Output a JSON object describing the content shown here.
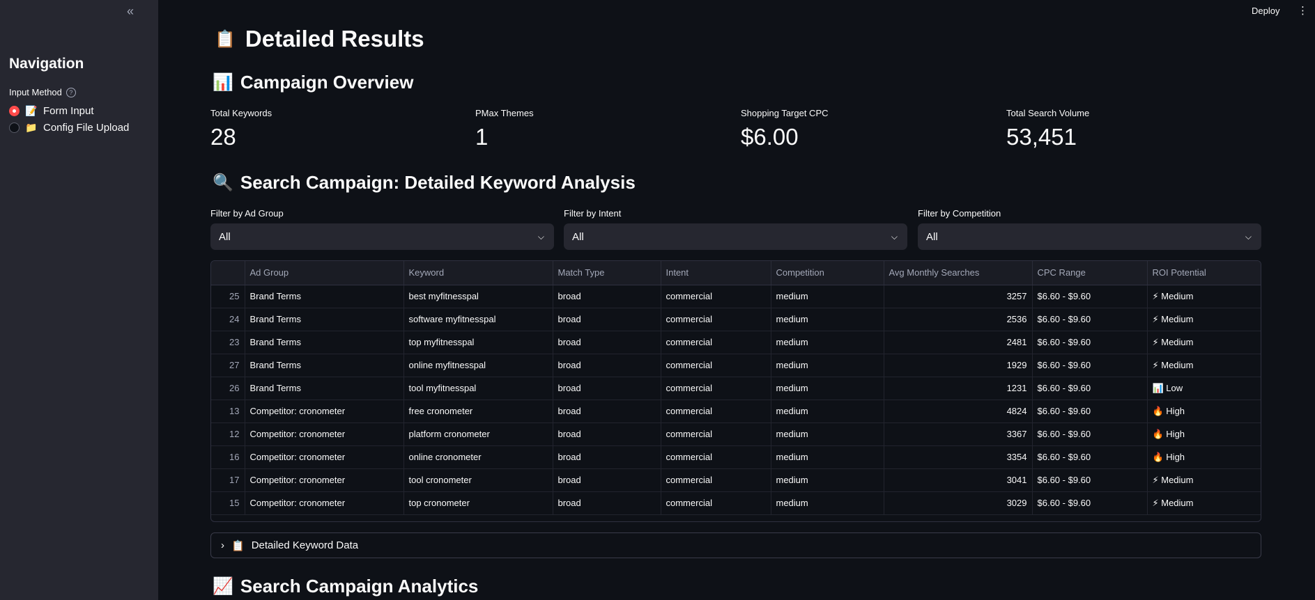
{
  "sidebar": {
    "collapse_glyph": "«",
    "title": "Navigation",
    "input_method_label": "Input Method",
    "help_glyph": "?",
    "options": [
      {
        "icon": "📝",
        "label": "Form Input",
        "selected": true
      },
      {
        "icon": "📁",
        "label": "Config File Upload",
        "selected": false
      }
    ]
  },
  "header": {
    "deploy_label": "Deploy",
    "menu_glyph": "⋮"
  },
  "main": {
    "title_icon": "📋",
    "title": "Detailed Results",
    "overview_icon": "📊",
    "overview_title": "Campaign Overview",
    "metrics": [
      {
        "label": "Total Keywords",
        "value": "28"
      },
      {
        "label": "PMax Themes",
        "value": "1"
      },
      {
        "label": "Shopping Target CPC",
        "value": "$6.00"
      },
      {
        "label": "Total Search Volume",
        "value": "53,451"
      }
    ],
    "search_icon": "🔍",
    "search_title": "Search Campaign: Detailed Keyword Analysis",
    "filters": [
      {
        "label": "Filter by Ad Group",
        "value": "All"
      },
      {
        "label": "Filter by Intent",
        "value": "All"
      },
      {
        "label": "Filter by Competition",
        "value": "All"
      }
    ],
    "table": {
      "columns": [
        "",
        "Ad Group",
        "Keyword",
        "Match Type",
        "Intent",
        "Competition",
        "Avg Monthly Searches",
        "CPC Range",
        "ROI Potential"
      ],
      "rows": [
        [
          "25",
          "Brand Terms",
          "best myfitnesspal",
          "broad",
          "commercial",
          "medium",
          "3257",
          "$6.60 - $9.60",
          "⚡ Medium"
        ],
        [
          "24",
          "Brand Terms",
          "software myfitnesspal",
          "broad",
          "commercial",
          "medium",
          "2536",
          "$6.60 - $9.60",
          "⚡ Medium"
        ],
        [
          "23",
          "Brand Terms",
          "top myfitnesspal",
          "broad",
          "commercial",
          "medium",
          "2481",
          "$6.60 - $9.60",
          "⚡ Medium"
        ],
        [
          "27",
          "Brand Terms",
          "online myfitnesspal",
          "broad",
          "commercial",
          "medium",
          "1929",
          "$6.60 - $9.60",
          "⚡ Medium"
        ],
        [
          "26",
          "Brand Terms",
          "tool myfitnesspal",
          "broad",
          "commercial",
          "medium",
          "1231",
          "$6.60 - $9.60",
          "📊 Low"
        ],
        [
          "13",
          "Competitor: cronometer",
          "free cronometer",
          "broad",
          "commercial",
          "medium",
          "4824",
          "$6.60 - $9.60",
          "🔥 High"
        ],
        [
          "12",
          "Competitor: cronometer",
          "platform cronometer",
          "broad",
          "commercial",
          "medium",
          "3367",
          "$6.60 - $9.60",
          "🔥 High"
        ],
        [
          "16",
          "Competitor: cronometer",
          "online cronometer",
          "broad",
          "commercial",
          "medium",
          "3354",
          "$6.60 - $9.60",
          "🔥 High"
        ],
        [
          "17",
          "Competitor: cronometer",
          "tool cronometer",
          "broad",
          "commercial",
          "medium",
          "3041",
          "$6.60 - $9.60",
          "⚡ Medium"
        ],
        [
          "15",
          "Competitor: cronometer",
          "top cronometer",
          "broad",
          "commercial",
          "medium",
          "3029",
          "$6.60 - $9.60",
          "⚡ Medium"
        ]
      ]
    },
    "expander": {
      "chevron": "›",
      "icon": "📋",
      "label": "Detailed Keyword Data"
    },
    "analytics_icon": "📈",
    "analytics_title": "Search Campaign Analytics"
  }
}
